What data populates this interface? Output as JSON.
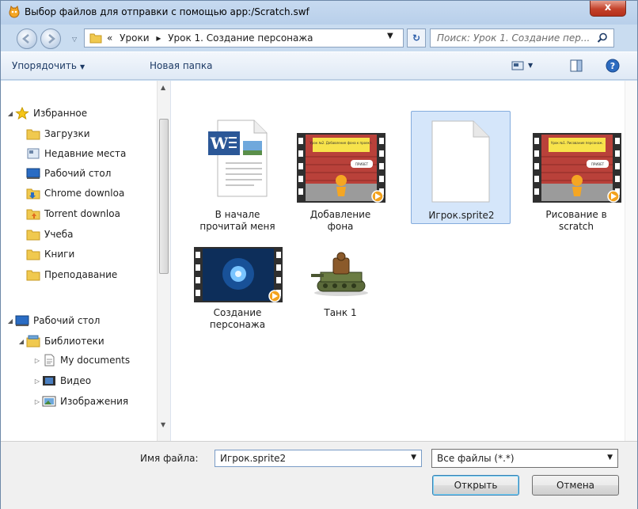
{
  "window": {
    "title": "Выбор файлов для отправки с помощью app:/Scratch.swf",
    "close_label": "x"
  },
  "addressbar": {
    "prefix": "«",
    "crumbs": [
      "Уроки",
      "Урок 1. Создание персонажа"
    ],
    "separator": "▸",
    "search_placeholder": "Поиск: Урок 1. Создание пер..."
  },
  "toolbar": {
    "organize_label": "Упорядочить",
    "new_folder_label": "Новая папка"
  },
  "nav": {
    "items": [
      {
        "label": "Избранное",
        "icon": "star-icon",
        "level": 0,
        "expander": "◢"
      },
      {
        "label": "Загрузки",
        "icon": "folder-icon",
        "level": 1
      },
      {
        "label": "Недавние места",
        "icon": "recent-places-icon",
        "level": 1
      },
      {
        "label": "Рабочий стол",
        "icon": "desktop-icon",
        "level": 1
      },
      {
        "label": "Chrome downloa",
        "icon": "download-folder-icon",
        "level": 1
      },
      {
        "label": "Torrent downloa",
        "icon": "torrent-folder-icon",
        "level": 1
      },
      {
        "label": "Учеба",
        "icon": "folder-icon",
        "level": 1
      },
      {
        "label": "Книги",
        "icon": "folder-icon",
        "level": 1
      },
      {
        "label": "Преподавание",
        "icon": "folder-icon",
        "level": 1
      },
      {
        "label": "Рабочий стол",
        "icon": "desktop-icon",
        "level": 0,
        "expander": "◢"
      },
      {
        "label": "Библиотеки",
        "icon": "libraries-icon",
        "level": 1,
        "expander": "◢"
      },
      {
        "label": "My documents",
        "icon": "documents-icon",
        "level": 2,
        "expander": "▷"
      },
      {
        "label": "Видео",
        "icon": "video-library-icon",
        "level": 2,
        "expander": "▷"
      },
      {
        "label": "Изображения",
        "icon": "pictures-icon",
        "level": 2,
        "expander": "▷"
      }
    ]
  },
  "files": [
    {
      "name": "В начале прочитай меня",
      "line1": "В начале",
      "line2": "прочитай меня",
      "type": "word-document-icon"
    },
    {
      "name": "Добавление фона",
      "line1": "Добавление",
      "line2": "фона",
      "type": "video-thumbnail",
      "overlay_title": "Урок №2. Добавление фона к проект.",
      "bubble": "ПРИВЕТ"
    },
    {
      "name": "Игрок.sprite2",
      "line1": "Игрок.sprite2",
      "line2": "",
      "type": "blank-file-icon",
      "selected": true
    },
    {
      "name": "Рисование в scratch",
      "line1": "Рисование в",
      "line2": "scratch",
      "type": "video-thumbnail",
      "overlay_title": "Урок №1. Рисование персонаж.",
      "bubble": "ПРИВЕТ"
    },
    {
      "name": "Создание персонажа",
      "line1": "Создание",
      "line2": "персонажа",
      "type": "video-thumbnail-blue"
    },
    {
      "name": "Танк 1",
      "line1": "Танк 1",
      "line2": "",
      "type": "tank-image"
    }
  ],
  "footer": {
    "filename_label": "Имя файла:",
    "filename_value": "Игрок.sprite2",
    "filetype_value": "Все файлы (*.*)",
    "open_label": "Открыть",
    "cancel_label": "Отмена"
  },
  "colors": {
    "chrome": "#c9dcf0",
    "selection": "#d5e6fa",
    "close_red": "#c3412a",
    "folder_yellow": "#f0c94f"
  }
}
